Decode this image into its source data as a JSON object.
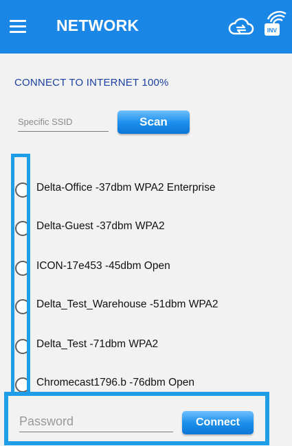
{
  "header": {
    "title": "NETWORK",
    "inv_badge": "INV",
    "accent_color": "#1a87e6",
    "icons": [
      "menu-icon",
      "cloud-sync-icon",
      "wifi-inverter-icon"
    ]
  },
  "status": {
    "text": "CONNECT TO INTERNET 100%"
  },
  "scan": {
    "ssid_placeholder": "Specific SSID",
    "ssid_value": "",
    "button_label": "Scan"
  },
  "networks": [
    {
      "label": "Delta-Office -37dbm WPA2 Enterprise",
      "selected": false
    },
    {
      "label": "Delta-Guest -37dbm WPA2",
      "selected": false
    },
    {
      "label": "ICON-17e453 -45dbm Open",
      "selected": false
    },
    {
      "label": "Delta_Test_Warehouse -51dbm WPA2",
      "selected": false
    },
    {
      "label": "Delta_Test -71dbm WPA2",
      "selected": false
    },
    {
      "label": "Chromecast1796.b -76dbm Open",
      "selected": false
    }
  ],
  "connect": {
    "password_placeholder": "Password",
    "password_value": "",
    "button_label": "Connect"
  },
  "highlight_color": "#1e9ee6"
}
